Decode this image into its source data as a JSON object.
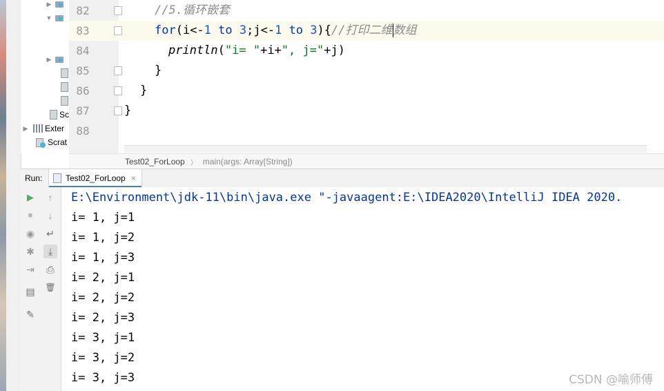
{
  "project_tree": {
    "items": [
      {
        "name": "",
        "kind": "folder",
        "expanded": false
      },
      {
        "name": "",
        "kind": "folder",
        "expanded": true
      },
      {
        "name": "",
        "kind": "folder",
        "expanded": false
      },
      {
        "name": "",
        "kind": "file"
      },
      {
        "name": "",
        "kind": "file"
      },
      {
        "name": "",
        "kind": "file"
      },
      {
        "name": "Sc",
        "kind": "scratch"
      },
      {
        "name": "Exter",
        "kind": "library"
      },
      {
        "name": "Scrat",
        "kind": "scratches"
      }
    ]
  },
  "editor": {
    "line_numbers": [
      "82",
      "83",
      "84",
      "85",
      "86",
      "87",
      "88"
    ],
    "code": {
      "l82_comment": "//5.循环嵌套",
      "l83_for": "for",
      "l83_open": "(i<-",
      "l83_n1": "1",
      "l83_to1": " to ",
      "l83_n3a": "3",
      "l83_mid": ";j<-",
      "l83_n1b": "1",
      "l83_to2": " to ",
      "l83_n3b": "3",
      "l83_close": "){",
      "l83_comment_a": "//打印二维",
      "l83_comment_b": "数组",
      "l84_fn": "println",
      "l84_p1": "(",
      "l84_s1": "\"i= \"",
      "l84_p2": "+i+",
      "l84_s2": "\", j=\"",
      "l84_p3": "+j)",
      "l85": "}",
      "l86": "}",
      "l87": "}"
    }
  },
  "breadcrumb": {
    "file": "Test02_ForLoop",
    "method": "main(args: Array[String])"
  },
  "run": {
    "label": "Run:",
    "tab_title": "Test02_ForLoop",
    "tab_close": "×",
    "command": "E:\\Environment\\jdk-11\\bin\\java.exe \"-javaagent:E:\\IDEA2020\\IntelliJ IDEA 2020.",
    "output": [
      "i= 1, j=1",
      "i= 1, j=2",
      "i= 1, j=3",
      "i= 2, j=1",
      "i= 2, j=2",
      "i= 2, j=3",
      "i= 3, j=1",
      "i= 3, j=2",
      "i= 3, j=3"
    ]
  },
  "toolbar": {
    "rerun": "▶",
    "stop": "■",
    "screenshot": "◉",
    "settings": "✱",
    "exit": "⇥",
    "layout": "▤",
    "pin": "✎",
    "up": "↑",
    "down": "↓",
    "soft_wrap": "↵",
    "scroll_end": "⤓",
    "print": "⎙",
    "trash": "🗑"
  },
  "watermark": "CSDN @喻师傅",
  "colors": {
    "keyword": "#0033b3",
    "number": "#1750eb",
    "string": "#067d17",
    "comment": "#8c8c8c",
    "current_line": "#fcfaed",
    "run_green": "#59a869"
  }
}
